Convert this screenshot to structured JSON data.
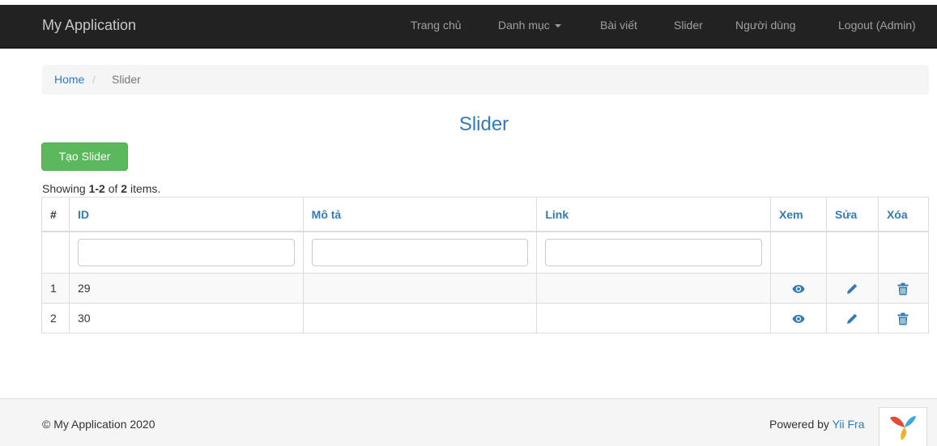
{
  "navbar": {
    "brand": "My Application",
    "items": [
      {
        "label": "Trang chủ"
      },
      {
        "label": "Danh mục"
      },
      {
        "label": "Bài viết"
      },
      {
        "label": "Slider"
      },
      {
        "label": "Người dùng"
      },
      {
        "label": "Logout (Admin)"
      }
    ]
  },
  "breadcrumb": {
    "home": "Home",
    "separator": "/",
    "current": "Slider"
  },
  "page": {
    "title": "Slider",
    "create_button": "Tạo Slider",
    "summary_prefix": "Showing ",
    "summary_range": "1-2",
    "summary_of": " of ",
    "summary_total": "2",
    "summary_suffix": " items."
  },
  "table": {
    "headers": [
      "#",
      "ID",
      "Mô tả",
      "Link",
      "Xem",
      "Sửa",
      "Xóa"
    ],
    "rows": [
      {
        "num": "1",
        "id": "29",
        "description": "",
        "link": ""
      },
      {
        "num": "2",
        "id": "30",
        "description": "",
        "link": ""
      }
    ],
    "action_icons": [
      "eye-icon",
      "pencil-icon",
      "trash-icon"
    ]
  },
  "footer": {
    "copyright": "© My Application 2020",
    "powered_prefix": "Powered by ",
    "powered_link": "Yii Fra"
  },
  "colors": {
    "navbar_bg": "#222222",
    "link": "#337ab7",
    "success": "#5cb85c"
  }
}
